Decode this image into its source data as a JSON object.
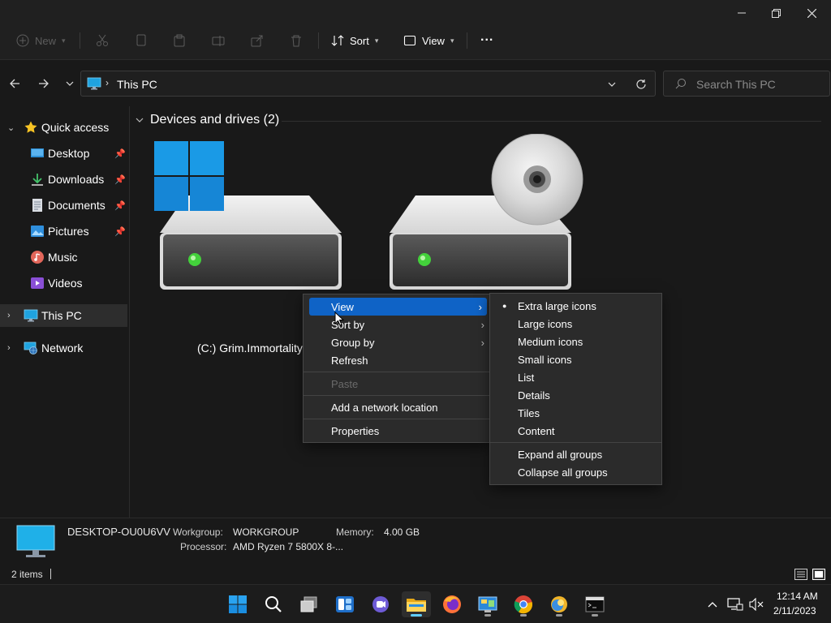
{
  "window": {
    "controls": [
      "minimize-icon",
      "restore-icon",
      "close-icon"
    ]
  },
  "toolbar": {
    "new_label": "New",
    "sort_label": "Sort",
    "view_label": "View",
    "more_label": "..."
  },
  "address": {
    "location": "This PC",
    "search_placeholder": "Search This PC"
  },
  "nav": {
    "quick_access": "Quick access",
    "items": [
      {
        "label": "Desktop"
      },
      {
        "label": "Downloads"
      },
      {
        "label": "Documents"
      },
      {
        "label": "Pictures"
      },
      {
        "label": "Music"
      },
      {
        "label": "Videos"
      }
    ],
    "this_pc": "This PC",
    "network": "Network"
  },
  "content": {
    "group_title": "Devices and drives (2)",
    "drive_c_label": "(C:) Grim.Immortality.X"
  },
  "context_menu": {
    "items": [
      "View",
      "Sort by",
      "Group by",
      "Refresh",
      "Paste",
      "Add a network location",
      "Properties"
    ]
  },
  "view_submenu": {
    "items": [
      "Extra large icons",
      "Large icons",
      "Medium icons",
      "Small icons",
      "List",
      "Details",
      "Tiles",
      "Content",
      "Expand all groups",
      "Collapse all groups"
    ],
    "selected": "Extra large icons"
  },
  "details": {
    "computer_name": "DESKTOP-OU0U6VV",
    "workgroup_label": "Workgroup:",
    "workgroup_value": "WORKGROUP",
    "memory_label": "Memory:",
    "memory_value": "4.00 GB",
    "processor_label": "Processor:",
    "processor_value": "AMD Ryzen 7 5800X 8-..."
  },
  "status": {
    "items_count": "2 items"
  },
  "taskbar": {
    "time": "12:14 AM",
    "date": "2/11/2023"
  },
  "colors": {
    "accent": "#0f63c6",
    "window_bg": "#191919",
    "menu_bg": "#2b2b2b"
  }
}
